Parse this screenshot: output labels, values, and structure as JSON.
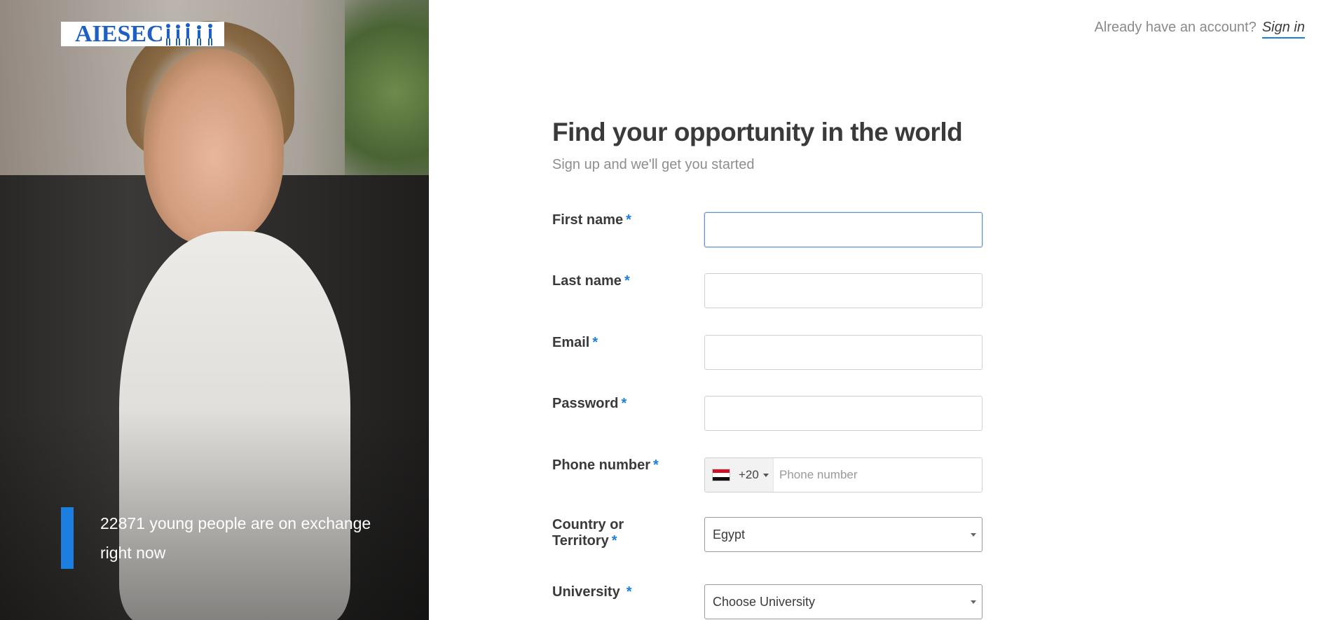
{
  "brand": {
    "logo_text": "AIESEC"
  },
  "hero": {
    "exchange_text": "22871 young people are on exchange right now"
  },
  "header": {
    "account_prompt": "Already have an account?",
    "signin_label": "Sign in"
  },
  "form": {
    "title": "Find your opportunity in the world",
    "subtitle": "Sign up and we'll get you started",
    "required_mark": "*",
    "fields": {
      "first_name": {
        "label": "First name",
        "value": ""
      },
      "last_name": {
        "label": "Last name",
        "value": ""
      },
      "email": {
        "label": "Email",
        "value": ""
      },
      "password": {
        "label": "Password",
        "value": ""
      },
      "phone": {
        "label": "Phone number",
        "dial_code": "+20",
        "placeholder": "Phone number",
        "value": "",
        "flag": "egypt-flag-icon"
      },
      "country": {
        "label_line1": "Country or",
        "label_line2": "Territory",
        "selected": "Egypt"
      },
      "university": {
        "label": "University",
        "selected": "Choose University"
      }
    }
  },
  "colors": {
    "accent": "#1c7fe0",
    "brand_blue": "#1d5fc2"
  }
}
